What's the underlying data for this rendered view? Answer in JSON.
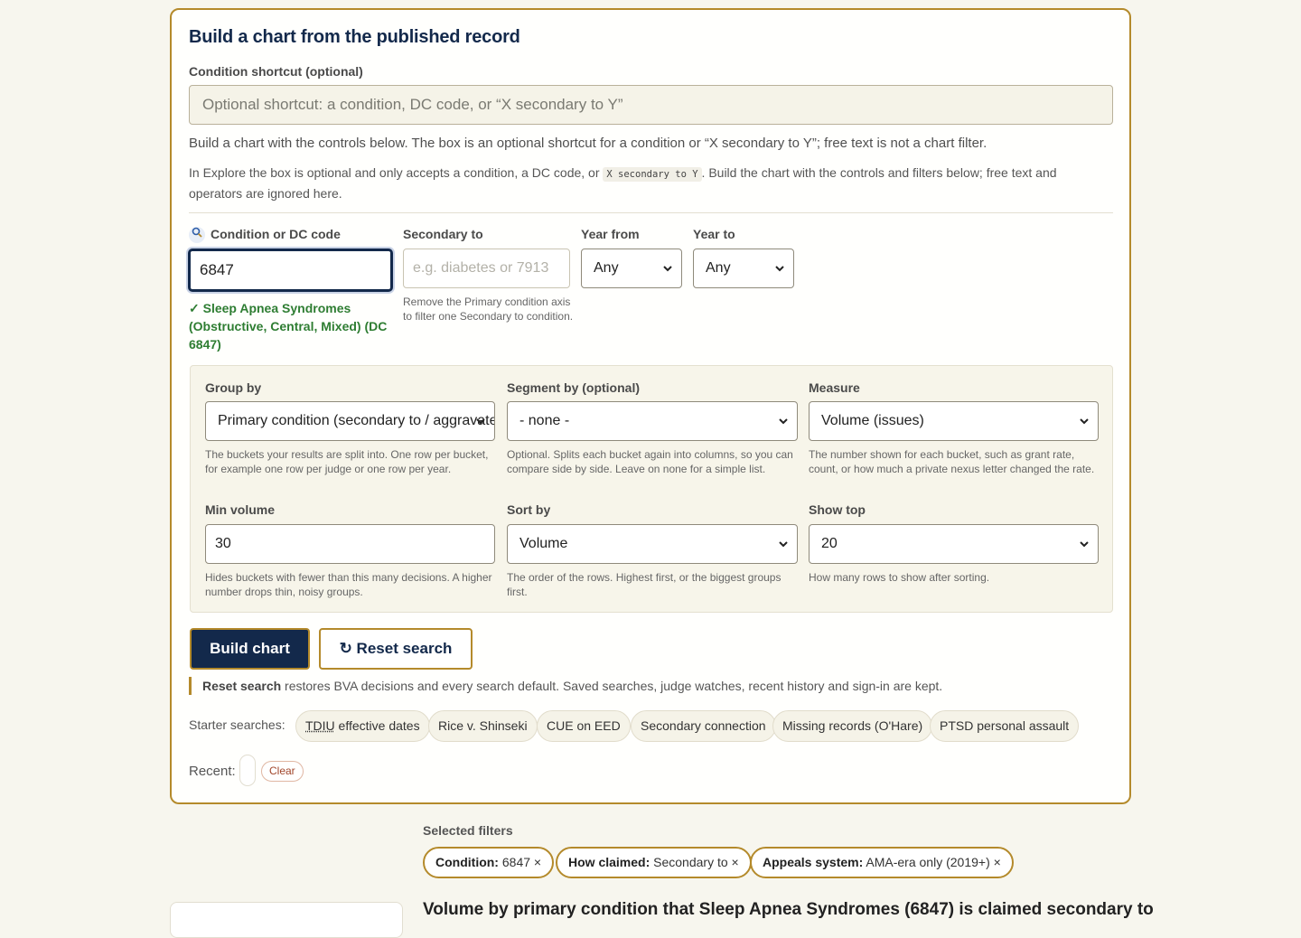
{
  "panel": {
    "title": "Build a chart from the published record",
    "shortcut_label": "Condition shortcut (optional)",
    "shortcut_placeholder": "Optional shortcut: a condition, DC code, or “X secondary to Y”",
    "help_main": "Build a chart with the controls below. The box is an optional shortcut for a condition or “X secondary to Y”; free text is not a chart filter.",
    "help_explore_a": "In Explore the box is optional and only accepts a condition, a DC code, or",
    "help_explore_code": "X secondary to Y",
    "help_explore_b": ". Build the chart with the controls and filters below; free text and operators are ignored here."
  },
  "filters": {
    "condition_label": "Condition or DC code",
    "condition_icon": "search-icon",
    "condition_value": "6847",
    "condition_match": "✓ Sleep Apnea Syndromes (Obstructive, Central, Mixed) (DC 6847)",
    "secondary_label": "Secondary to",
    "secondary_placeholder": "e.g. diabetes or 7913",
    "secondary_help": "Remove the Primary condition axis to filter one Secondary to condition.",
    "year_from_label": "Year from",
    "year_from_value": "Any",
    "year_to_label": "Year to",
    "year_to_value": "Any"
  },
  "options": {
    "group_by_label": "Group by",
    "group_by_value": "Primary condition (secondary to / aggravated)",
    "group_by_help": "The buckets your results are split into. One row per bucket, for example one row per judge or one row per year.",
    "segment_label": "Segment by (optional)",
    "segment_value": "- none -",
    "segment_help": "Optional. Splits each bucket again into columns, so you can compare side by side. Leave on none for a simple list.",
    "measure_label": "Measure",
    "measure_value": "Volume (issues)",
    "measure_help": "The number shown for each bucket, such as grant rate, count, or how much a private nexus letter changed the rate.",
    "min_volume_label": "Min volume",
    "min_volume_value": "30",
    "min_volume_help": "Hides buckets with fewer than this many decisions. A higher number drops thin, noisy groups.",
    "sort_label": "Sort by",
    "sort_value": "Volume",
    "sort_help": "The order of the rows. Highest first, or the biggest groups first.",
    "show_top_label": "Show top",
    "show_top_value": "20",
    "show_top_help": "How many rows to show after sorting."
  },
  "actions": {
    "build_label": "Build chart",
    "reset_icon": "refresh-icon",
    "reset_label": "↻ Reset search",
    "reset_note_bold": "Reset search",
    "reset_note": " restores BVA decisions and every search default. Saved searches, judge watches, recent history and sign-in are kept."
  },
  "starter": {
    "label": "Starter searches:",
    "items": [
      "TDIU effective dates",
      "Rice v. Shinseki",
      "CUE on EED",
      "Secondary connection",
      "Missing records (O'Hare)",
      "PTSD personal assault"
    ],
    "tdiu_abbr": "TDIU",
    "tdiu_rest": " effective dates"
  },
  "recent": {
    "label": "Recent:",
    "clear_label": "Clear"
  },
  "selected": {
    "title": "Selected filters",
    "chips": [
      {
        "key": "Condition:",
        "value": " 6847 ×"
      },
      {
        "key": "How claimed:",
        "value": " Secondary to ×"
      },
      {
        "key": "Appeals system:",
        "value": " AMA-era only (2019+) ×"
      }
    ]
  },
  "result": {
    "title": "Volume by primary condition that Sleep Apnea Syndromes (6847) is claimed secondary to"
  }
}
